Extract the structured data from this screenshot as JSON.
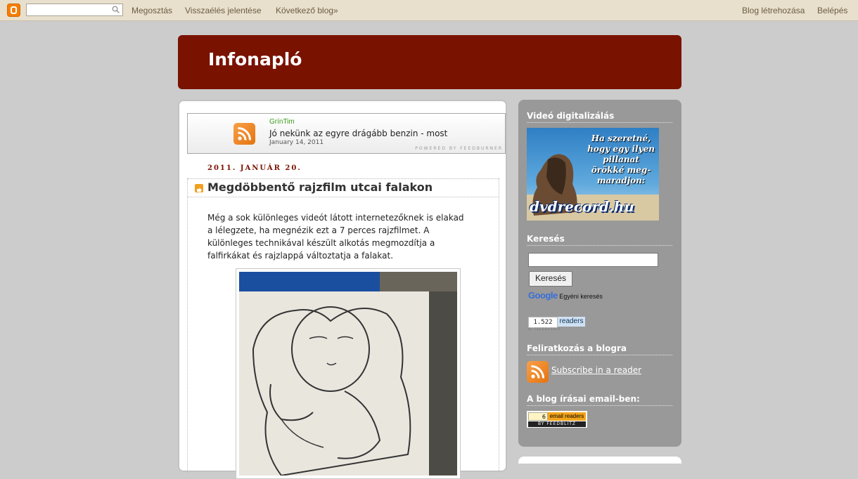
{
  "navbar": {
    "search_value": "",
    "links": [
      "Megosztás",
      "Visszaélés jelentése",
      "Következő blog»"
    ],
    "right_links": [
      "Blog létrehozása",
      "Belépés"
    ]
  },
  "blog": {
    "title": "Infonapló"
  },
  "feed_widget": {
    "author": "GrínTim",
    "title": "Jó nekünk az egyre drágább benzin - most",
    "date": "January 14, 2011",
    "powered": "POWERED BY FEEDBURNER"
  },
  "post": {
    "date": "2011. JANUÁR 20.",
    "title": "Megdöbbentő rajzfilm utcai falakon",
    "body": "Még a sok különleges videót látott internetezőknek is elakad a lélegzete, ha megnézik ezt a 7 perces rajzfilmet. A különleges technikával készült alkotás megmozdítja a falfirkákat és rajzlappá változtatja a falakat."
  },
  "sidebar": {
    "video_heading": "Videó digitalizálás",
    "promo_slogan": [
      "Ha szeretné,",
      "hogy egy ilyen",
      "pillanat",
      "örökké meg-",
      "maradjon:"
    ],
    "promo_domain": "dvdrecord.hu",
    "search_heading": "Keresés",
    "search_input_value": "",
    "search_button": "Keresés",
    "google_logo": "Google",
    "google_caption": "Egyéni keresés",
    "readers_count": "1.522",
    "readers_label": "readers",
    "readers_by": "BY FEEDBURNER",
    "subscribe_heading": "Feliratkozás a blogra",
    "subscribe_link": "Subscribe in a reader",
    "email_heading": "A blog írásai email-ben:",
    "email_count": "6",
    "email_label": "email readers",
    "email_by": "BY FEEDBLITZ"
  },
  "colors": {
    "header_bg": "#7a1200",
    "sidebar_bg": "#999999",
    "page_bg": "#cccccc",
    "navbar_bg": "#e8dfcc"
  }
}
